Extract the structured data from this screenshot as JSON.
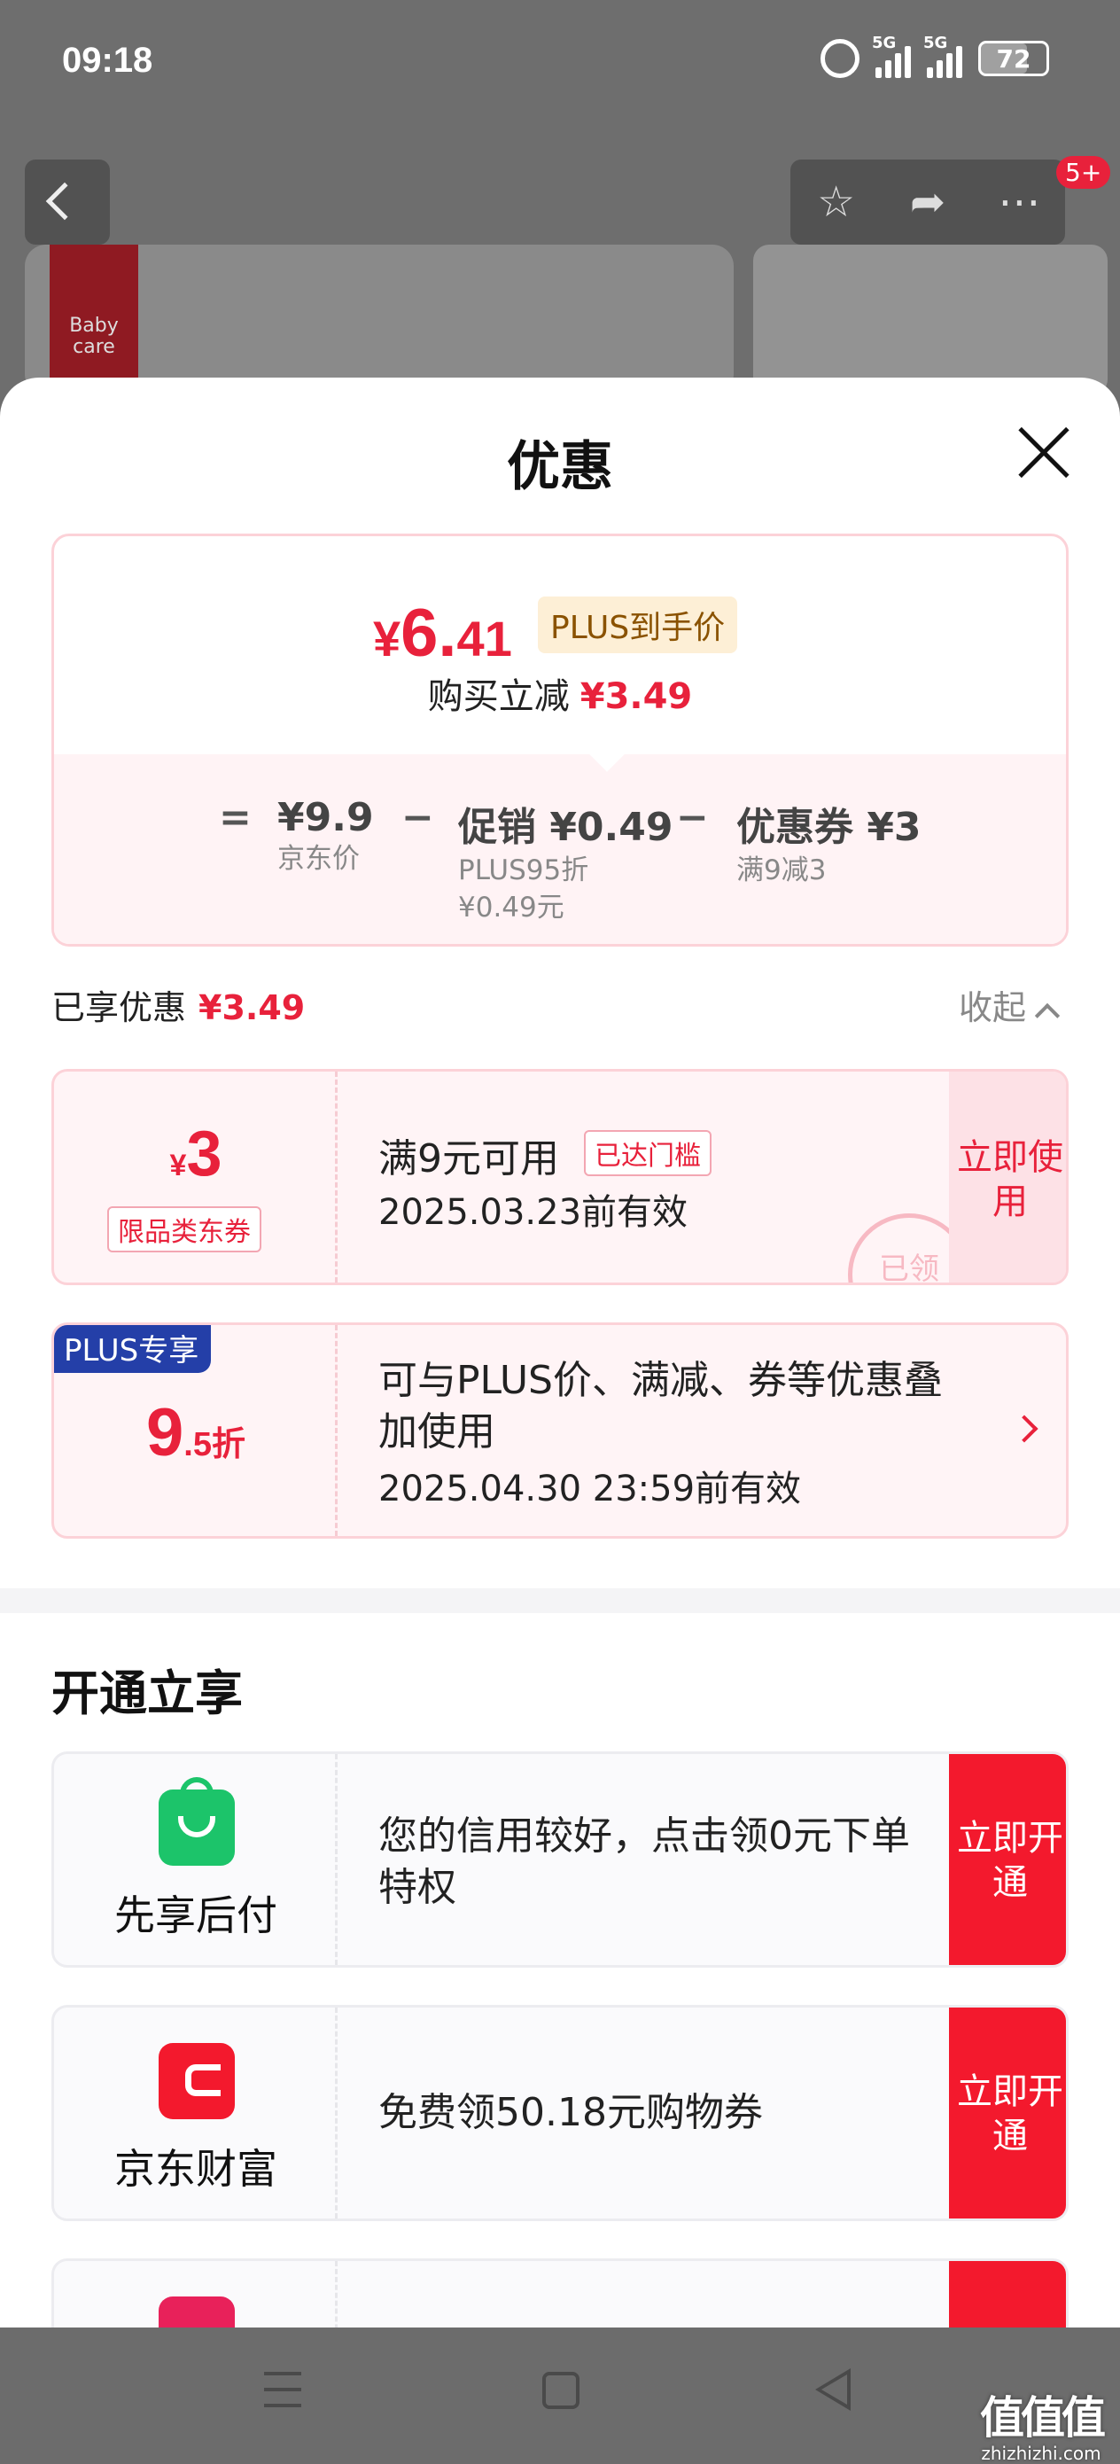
{
  "status_bar": {
    "time": "09:18",
    "signal1": "5G",
    "signal2": "5G",
    "battery": "72"
  },
  "top": {
    "badge": "5+",
    "brand": "Baby care"
  },
  "sheet": {
    "title": "优惠"
  },
  "price_summary": {
    "currency": "¥",
    "price_int": "6.",
    "price_dec": "41",
    "tag": "PLUS到手价",
    "reduce_label": "购买立减",
    "reduce_value": "¥3.49",
    "eq": "=",
    "minus": "−",
    "base_value": "¥9.9",
    "base_label": "京东价",
    "promo_value": "促销 ¥0.49",
    "promo_sub1": "PLUS95折",
    "promo_sub2": "¥0.49元",
    "coupon_value": "优惠券 ¥3",
    "coupon_sub": "满9减3"
  },
  "enjoyed": {
    "label": "已享优惠",
    "value": "¥3.49",
    "collapse": "收起"
  },
  "coupon1": {
    "currency": "¥",
    "amount": "3",
    "type": "限品类东券",
    "condition": "满9元可用",
    "status_tag": "已达门槛",
    "validity": "2025.03.23前有效",
    "button": "立即使用",
    "stamp": "已领"
  },
  "coupon2": {
    "badge": "PLUS专享",
    "discount_big": "9",
    "discount_small": ".5折",
    "description": "可与PLUS价、满减、券等优惠叠加使用",
    "validity": "2025.04.30 23:59前有效"
  },
  "open_section": {
    "title": "开通立享",
    "services": [
      {
        "name": "先享后付",
        "text": "您的信用较好，点击领0元下单特权",
        "button": "立即开通",
        "icon": "shopping-bag-icon",
        "color": "#1cc46a"
      },
      {
        "name": "京东财富",
        "text": "免费领50.18元购物券",
        "button": "立即开通",
        "icon": "wallet-icon",
        "color": "#f3192d"
      },
      {
        "name": "",
        "text": "",
        "button": "",
        "icon": "card-icon",
        "color": "#e8215a"
      }
    ]
  },
  "watermark": {
    "main": "值值值",
    "sub": "zhizhizhi.com"
  }
}
